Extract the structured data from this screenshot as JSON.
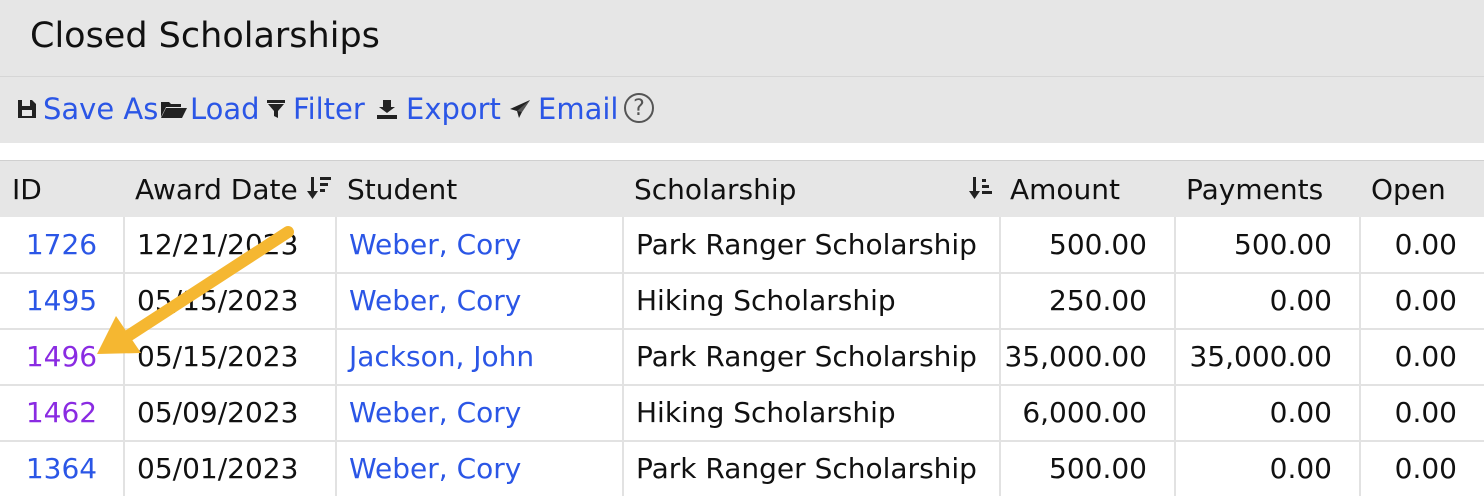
{
  "page": {
    "title": "Closed Scholarships"
  },
  "toolbar": {
    "save_as": "Save As",
    "load": "Load",
    "filter": "Filter",
    "export": "Export",
    "email": "Email",
    "help": "?"
  },
  "table": {
    "headers": {
      "id": "ID",
      "award_date": "Award Date",
      "student": "Student",
      "scholarship": "Scholarship",
      "amount": "Amount",
      "payments": "Payments",
      "open": "Open"
    },
    "rows": [
      {
        "id": "1726",
        "award_date": "12/21/2023",
        "student": "Weber, Cory",
        "scholarship": "Park Ranger Scholarship",
        "amount": "500.00",
        "payments": "500.00",
        "open": "0.00",
        "id_visited": false
      },
      {
        "id": "1495",
        "award_date": "05/15/2023",
        "student": "Weber, Cory",
        "scholarship": "Hiking Scholarship",
        "amount": "250.00",
        "payments": "0.00",
        "open": "0.00",
        "id_visited": false
      },
      {
        "id": "1496",
        "award_date": "05/15/2023",
        "student": "Jackson, John",
        "scholarship": "Park Ranger Scholarship",
        "amount": "35,000.00",
        "payments": "35,000.00",
        "open": "0.00",
        "id_visited": true
      },
      {
        "id": "1462",
        "award_date": "05/09/2023",
        "student": "Weber, Cory",
        "scholarship": "Hiking Scholarship",
        "amount": "6,000.00",
        "payments": "0.00",
        "open": "0.00",
        "id_visited": true
      },
      {
        "id": "1364",
        "award_date": "05/01/2023",
        "student": "Weber, Cory",
        "scholarship": "Park Ranger Scholarship",
        "amount": "500.00",
        "payments": "0.00",
        "open": "0.00",
        "id_visited": false
      }
    ]
  },
  "colors": {
    "link": "#2b56e6",
    "visited_link": "#8a2be2",
    "header_bg": "#e6e6e6",
    "annotation_arrow": "#f5b731"
  },
  "icons": {
    "save_as": "save-icon",
    "load": "folder-open-icon",
    "filter": "filter-icon",
    "export": "export-icon",
    "email": "send-icon",
    "help": "help-icon",
    "award_date_sort": "sort-descending-icon",
    "scholarship_sort": "sort-ascending-icon"
  }
}
